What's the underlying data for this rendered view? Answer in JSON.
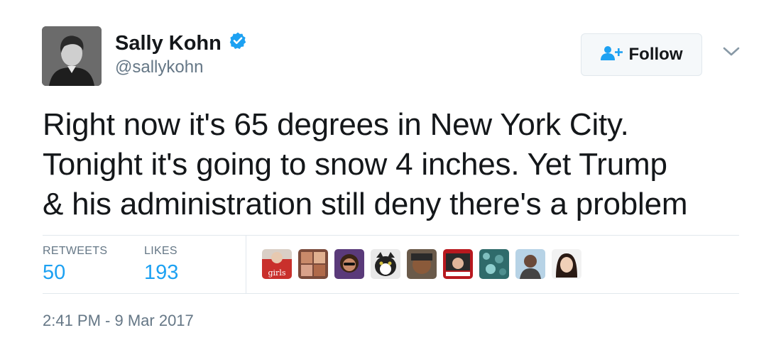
{
  "author": {
    "display_name": "Sally Kohn",
    "handle": "@sallykohn",
    "avatar_icon": "avatar-photo"
  },
  "follow_button": {
    "label": "Follow",
    "icon": "add-user-icon"
  },
  "tweet": {
    "lines": [
      "Right now it's 65 degrees in New York City.",
      "Tonight it's going to snow 4 inches. Yet Trump",
      "& his administration still deny there's a problem"
    ]
  },
  "stats": {
    "retweets_label": "RETWEETS",
    "retweets_value": "50",
    "likes_label": "LIKES",
    "likes_value": "193"
  },
  "liker_avatars": [
    {
      "caption": "girls"
    },
    {},
    {},
    {},
    {},
    {},
    {},
    {},
    {}
  ],
  "timestamp": "2:41 PM - 9 Mar 2017",
  "colors": {
    "accent": "#1da1f2",
    "secondary_text": "#657786",
    "primary_text": "#14171a",
    "border": "#e1e8ed"
  }
}
